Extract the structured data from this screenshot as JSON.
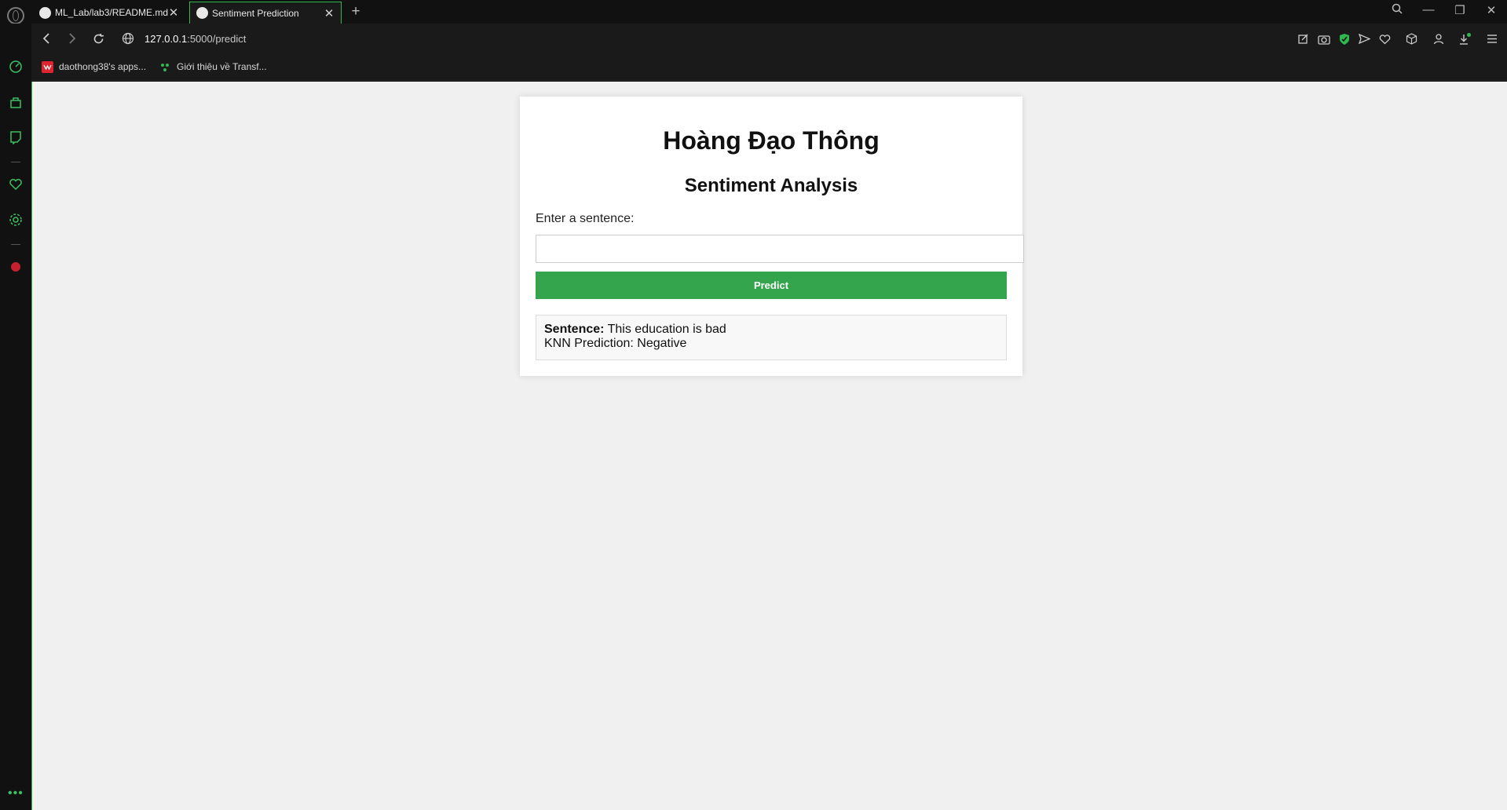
{
  "tabs": [
    {
      "label": "ML_Lab/lab3/README.md",
      "icon": "github-icon",
      "active": false
    },
    {
      "label": "Sentiment Prediction",
      "icon": "globe-icon",
      "active": true
    }
  ],
  "address": {
    "host": "127.0.0.1",
    "path": ":5000/predict"
  },
  "bookmarks": [
    {
      "label": "daothong38's apps...",
      "icon": "app-icon"
    },
    {
      "label": "Giới thiệu về Transf...",
      "icon": "site-icon"
    }
  ],
  "page": {
    "title": "Hoàng Đạo Thông",
    "subtitle": "Sentiment Analysis",
    "input_label": "Enter a sentence:",
    "input_value": "",
    "button_label": "Predict",
    "result": {
      "sentence_label": "Sentence:",
      "sentence_value": "This education is bad",
      "prediction": "KNN Prediction: Negative"
    }
  },
  "colors": {
    "accent": "#2fb84f",
    "button": "#34a54d",
    "page_bg": "#f0f0f0"
  }
}
